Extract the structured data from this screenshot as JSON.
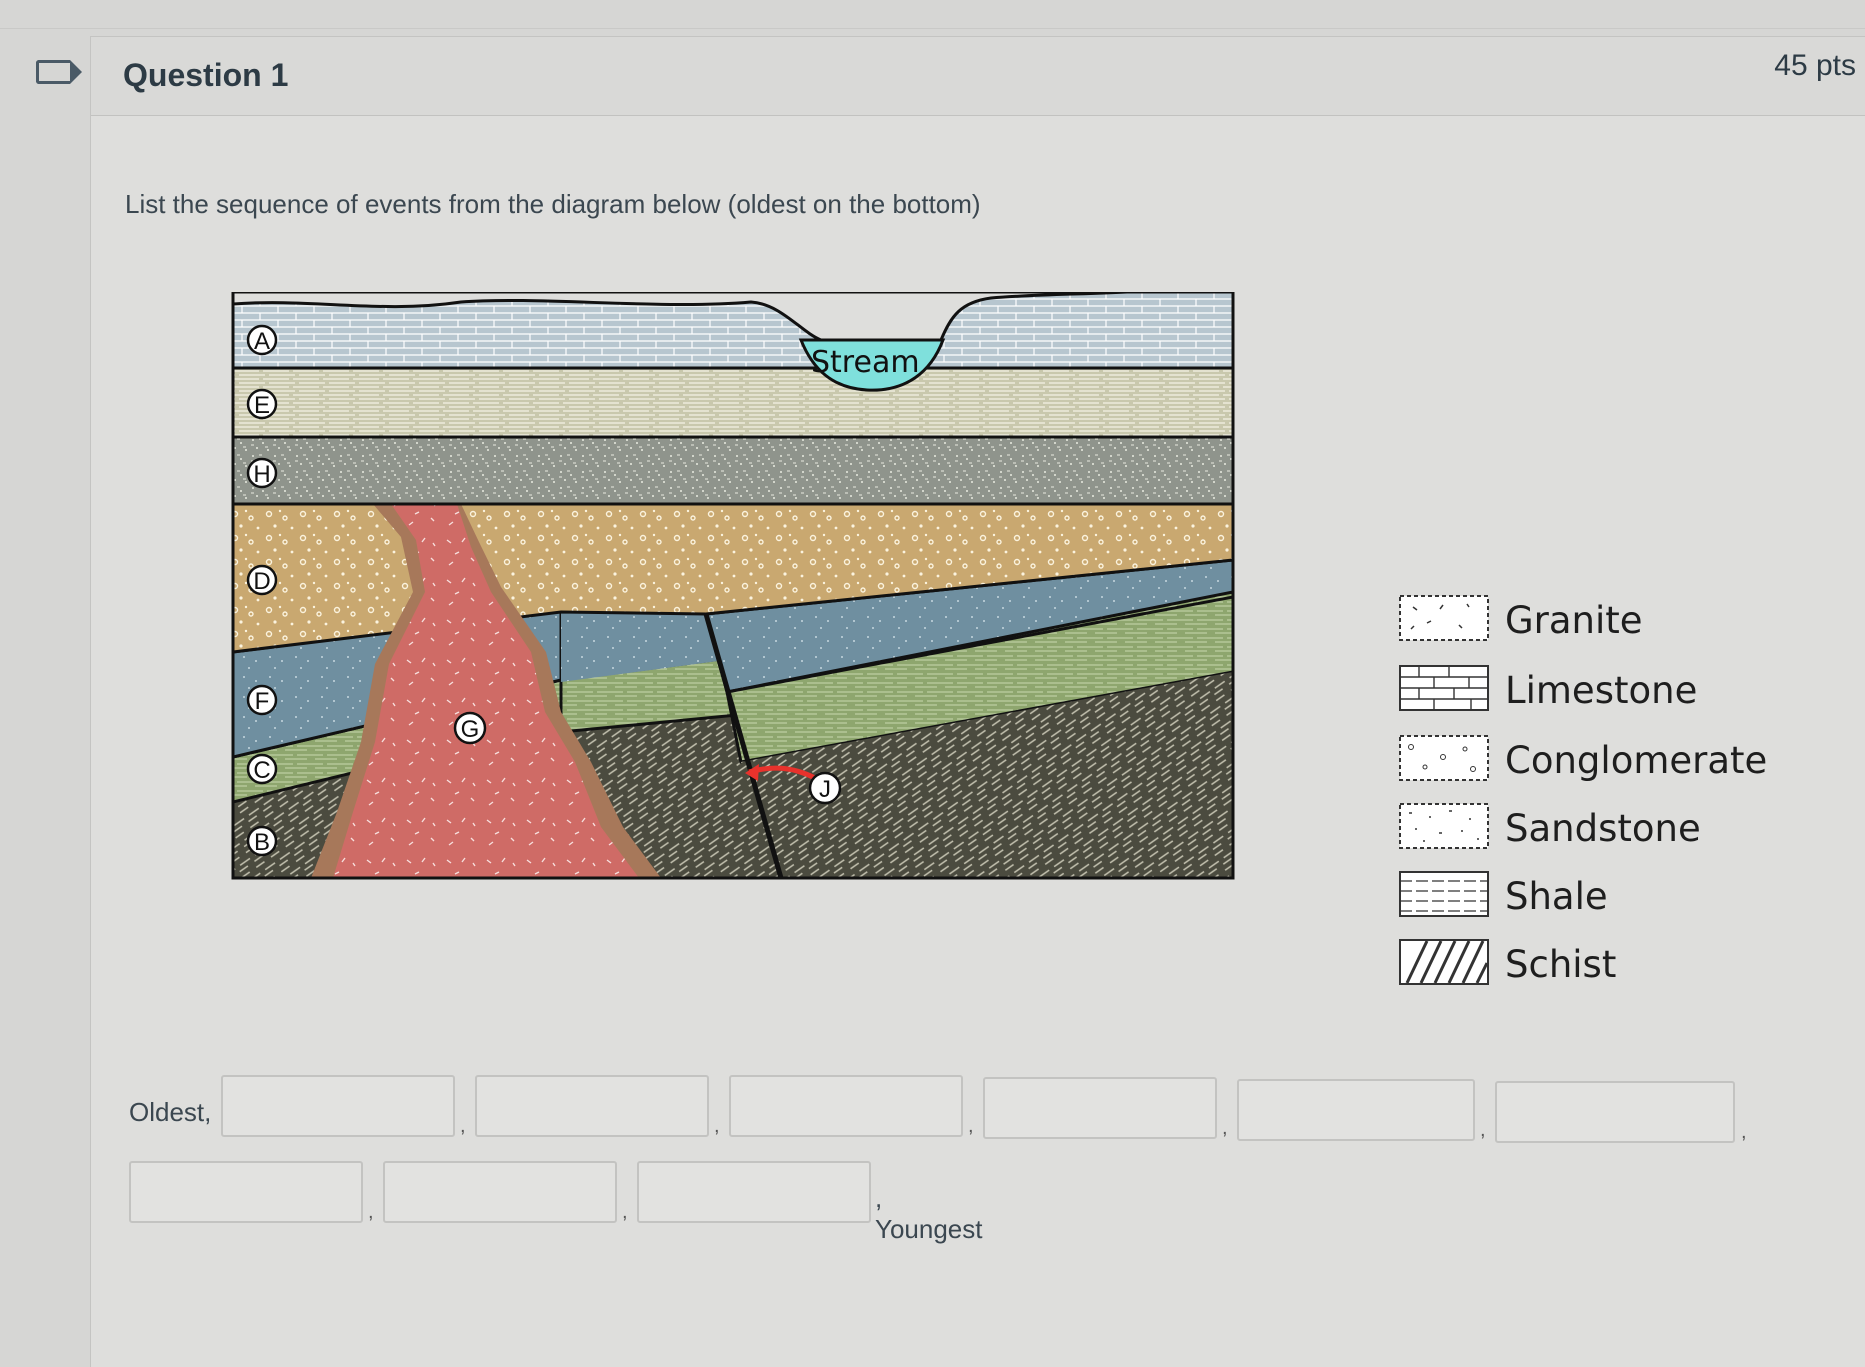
{
  "question": {
    "title": "Question 1",
    "points": "45 pts",
    "prompt": "List the sequence of events from the diagram below  (oldest on the bottom)"
  },
  "diagram": {
    "stream_label": "Stream",
    "layer_labels": [
      "A",
      "E",
      "H",
      "D",
      "F",
      "C",
      "B"
    ],
    "intrusion_label": "G",
    "fault_label": "J"
  },
  "legend": [
    {
      "label": "Granite",
      "icon": "granite-swatch"
    },
    {
      "label": "Limestone",
      "icon": "limestone-swatch"
    },
    {
      "label": "Conglomerate",
      "icon": "conglomerate-swatch"
    },
    {
      "label": "Sandstone",
      "icon": "sandstone-swatch"
    },
    {
      "label": "Shale",
      "icon": "shale-swatch"
    },
    {
      "label": "Schist",
      "icon": "schist-swatch"
    }
  ],
  "answers": {
    "start_label": "Oldest,",
    "end_label": ", Youngest",
    "separator": ",",
    "values": [
      "",
      "",
      "",
      "",
      "",
      "",
      "",
      "",
      ""
    ]
  },
  "colors": {
    "limestone": "#b7c6cf",
    "shale": "#c9c8ad",
    "sandstone_h": "#8f948c",
    "conglomerate": "#c9a870",
    "layer_f": "#6f8fa0",
    "layer_c": "#8ea66e",
    "schist": "#4b4b3f",
    "granite": "#cf6b66",
    "stream": "#7fe0dc",
    "fault_arrow": "#e8322c"
  }
}
